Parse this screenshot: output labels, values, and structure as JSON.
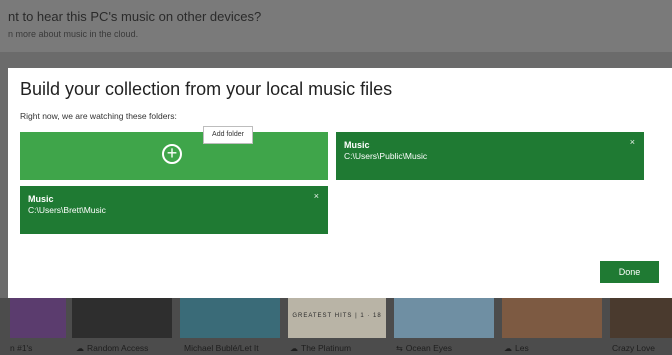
{
  "background": {
    "banner_heading": "nt to hear this PC's music on other devices?",
    "banner_subtext": "n more about music in the cloud.",
    "tiles": [
      {
        "caption": "n #1's",
        "cloud": false,
        "color": "#5b3c6e"
      },
      {
        "caption": "Random Access",
        "cloud": true,
        "color": "#2e2e2e"
      },
      {
        "caption": "Michael Bublé/Let It",
        "cloud": false,
        "color": "#3a6b78"
      },
      {
        "caption": "The Platinum",
        "cloud": true,
        "color": "#b9b4a6",
        "art_text": "GREATEST HITS | 1 · 18"
      },
      {
        "caption": "Ocean Eyes",
        "cloud": false,
        "color": "#6f8fa3"
      },
      {
        "caption": "Les",
        "cloud": true,
        "color": "#7d5a42"
      },
      {
        "caption": "Crazy Love",
        "cloud": false,
        "color": "#4a3a2e"
      }
    ]
  },
  "dialog": {
    "title": "Build your collection from your local music files",
    "subtitle": "Right now, we are watching these folders:",
    "add_folder_tooltip": "Add folder",
    "folders": [
      {
        "name": "Music",
        "path": "C:\\Users\\Public\\Music"
      },
      {
        "name": "Music",
        "path": "C:\\Users\\Brett\\Music"
      }
    ],
    "remove_glyph": "×",
    "done_label": "Done"
  },
  "colors": {
    "accent_green": "#3fa54a",
    "folder_green": "#1f7a33"
  }
}
